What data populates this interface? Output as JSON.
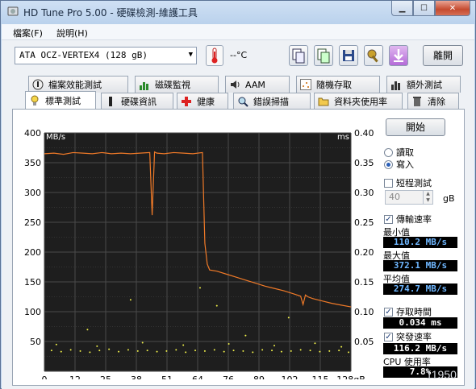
{
  "window": {
    "title": "HD Tune Pro  5.00 - 硬碟檢測-維護工具"
  },
  "menu": [
    {
      "label": "檔案(F)"
    },
    {
      "label": "說明(H)"
    }
  ],
  "toolbar": {
    "drive": "ATA    OCZ-VERTEX4    (128 gB)",
    "temperature": "--°C",
    "exit_label": "離開"
  },
  "tabs_row1": [
    {
      "label": "檔案效能測試"
    },
    {
      "label": "磁碟監視"
    },
    {
      "label": "AAM"
    },
    {
      "label": "隨機存取"
    },
    {
      "label": "額外測試"
    }
  ],
  "tabs_row2": [
    {
      "label": "標準測試"
    },
    {
      "label": "硬碟資訊"
    },
    {
      "label": "健康"
    },
    {
      "label": "錯誤掃描"
    },
    {
      "label": "資料夾使用率"
    },
    {
      "label": "清除"
    }
  ],
  "controls": {
    "start_label": "開始",
    "read_label": "讀取",
    "write_label": "寫入",
    "short_test_label": "短程測試",
    "short_test_size": "40",
    "size_unit": "gB",
    "transfer_rate_label": "傳輸速率",
    "min_label": "最小值",
    "min_value": "110.2 MB/s",
    "max_label": "最大值",
    "max_value": "372.1 MB/s",
    "avg_label": "平均值",
    "avg_value": "274.7 MB/s",
    "access_time_label": "存取時間",
    "access_time_value": "0.034 ms",
    "burst_rate_label": "突發速率",
    "burst_rate_value": "116.2 MB/s",
    "cpu_label": "CPU 使用率",
    "cpu_value": "7.8%"
  },
  "watermark": "11950",
  "colors": {
    "transfer_line": "#f07a28",
    "access_points": "#f0f04a",
    "plot_bg": "#1e1e1e",
    "grid": "#4a4a4a",
    "value_text": "#6fb7ff"
  },
  "chart_data": {
    "type": "line",
    "xlabel": "gB",
    "ylabel_left": "MB/s",
    "ylabel_right": "ms",
    "xlim": [
      0,
      128
    ],
    "ylim_left": [
      0,
      400
    ],
    "ylim_right": [
      0,
      0.4
    ],
    "x_ticks": [
      "0",
      "12",
      "25",
      "38",
      "51",
      "64",
      "76",
      "89",
      "102",
      "115",
      "128gB"
    ],
    "y_left_ticks": [
      "400",
      "350",
      "300",
      "250",
      "200",
      "150",
      "100",
      "50"
    ],
    "y_right_ticks": [
      "0.40",
      "0.35",
      "0.30",
      "0.25",
      "0.20",
      "0.15",
      "0.10",
      "0.05"
    ],
    "grid": true,
    "series": [
      {
        "name": "傳輸速率",
        "axis": "left",
        "x": [
          0,
          4,
          8,
          12,
          16,
          20,
          24,
          28,
          32,
          36,
          40,
          44,
          45,
          46,
          47,
          50,
          54,
          58,
          62,
          66,
          67,
          68,
          69,
          72,
          76,
          80,
          84,
          88,
          92,
          96,
          100,
          104,
          107,
          108,
          109,
          110,
          112,
          116,
          120,
          124,
          128
        ],
        "y": [
          365,
          366,
          364,
          367,
          366,
          365,
          367,
          365,
          366,
          365,
          366,
          367,
          262,
          368,
          366,
          365,
          367,
          366,
          365,
          367,
          215,
          180,
          170,
          168,
          163,
          158,
          153,
          148,
          143,
          139,
          135,
          130,
          126,
          112,
          128,
          125,
          122,
          118,
          114,
          111,
          108
        ]
      },
      {
        "name": "存取時間",
        "axis": "right",
        "style": "scatter",
        "x": [
          3,
          7,
          11,
          15,
          19,
          23,
          27,
          31,
          35,
          39,
          43,
          47,
          51,
          55,
          59,
          63,
          67,
          71,
          75,
          79,
          83,
          87,
          91,
          95,
          99,
          103,
          107,
          111,
          115,
          119,
          123,
          127,
          5,
          22,
          41,
          58,
          77,
          96,
          113,
          124,
          36,
          72,
          84,
          102,
          18,
          65
        ],
        "y": [
          0.035,
          0.033,
          0.036,
          0.034,
          0.032,
          0.035,
          0.037,
          0.033,
          0.036,
          0.034,
          0.035,
          0.033,
          0.034,
          0.036,
          0.032,
          0.035,
          0.034,
          0.036,
          0.033,
          0.035,
          0.034,
          0.032,
          0.036,
          0.035,
          0.033,
          0.034,
          0.036,
          0.035,
          0.033,
          0.034,
          0.035,
          0.032,
          0.045,
          0.042,
          0.048,
          0.044,
          0.046,
          0.043,
          0.047,
          0.041,
          0.12,
          0.11,
          0.06,
          0.09,
          0.07,
          0.14
        ]
      }
    ]
  }
}
